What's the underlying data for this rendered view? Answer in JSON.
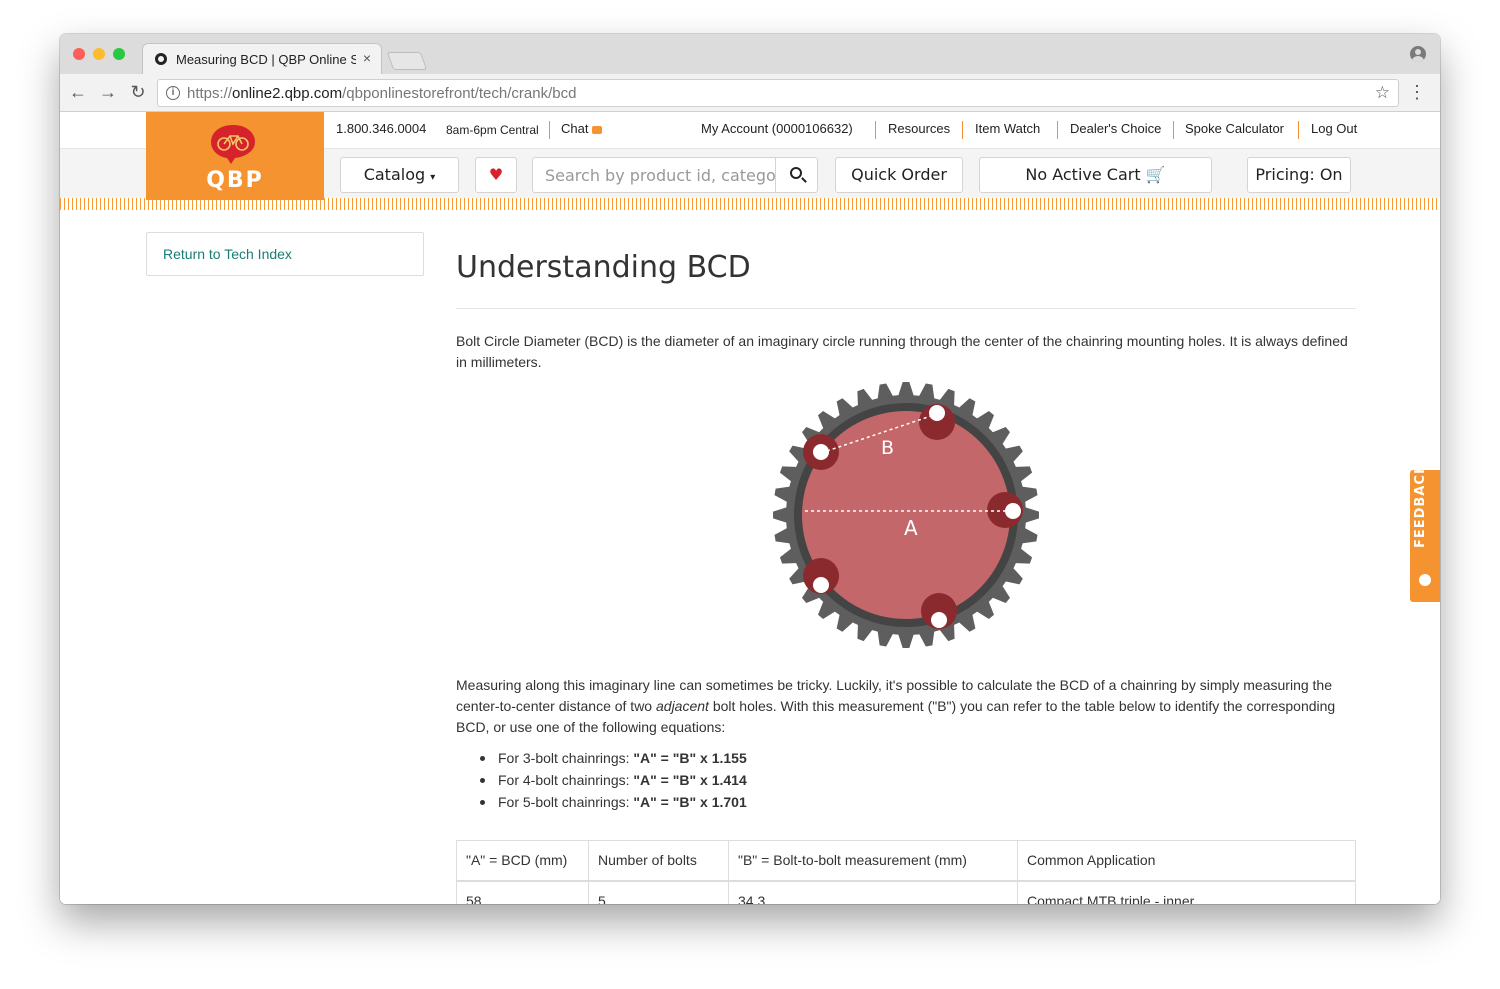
{
  "browser": {
    "tab_title": "Measuring BCD | QBP Online S",
    "tab_close": "×",
    "url_scheme": "https://",
    "url_host": "online2.qbp.com",
    "url_path": "/qbponlinestorefront/tech/crank/bcd"
  },
  "header": {
    "logo_text": "QBP",
    "phone": "1.800.346.0004",
    "hours": "8am-6pm Central",
    "chat": "Chat",
    "links": [
      "My Account (0000106632)",
      "Resources",
      "Item Watch",
      "Dealer's Choice",
      "Spoke Calculator",
      "Log Out"
    ]
  },
  "nav": {
    "catalog": "Catalog",
    "search_placeholder": "Search by product id, category, brand",
    "quick_order": "Quick Order",
    "cart": "No Active Cart",
    "pricing": "Pricing: On"
  },
  "sidebar": {
    "return_link": "Return to Tech Index"
  },
  "content": {
    "title": "Understanding BCD",
    "intro": "Bolt Circle Diameter (BCD) is the diameter of an imaginary circle running through the center of the chainring mounting holes. It is always defined in millimeters.",
    "diagram_labels": {
      "a": "A",
      "b": "B"
    },
    "p2_before": "Measuring along this imaginary line can sometimes be tricky. Luckily, it's possible to calculate the BCD of a chainring by simply measuring the center-to-center distance of two ",
    "p2_em": "adjacent",
    "p2_after": " bolt holes. With this measurement (\"B\") you can refer to the table below to identify the corresponding BCD, or use one of the following equations:",
    "bullets": [
      {
        "text": "For 3-bolt chainrings: ",
        "formula": "\"A\" = \"B\" x 1.155"
      },
      {
        "text": "For 4-bolt chainrings: ",
        "formula": "\"A\" = \"B\" x 1.414"
      },
      {
        "text": "For 5-bolt chainrings: ",
        "formula": "\"A\" = \"B\" x 1.701"
      }
    ],
    "table": {
      "headers": [
        "\"A\" = BCD (mm)",
        "Number of bolts",
        "\"B\" = Bolt-to-bolt measurement (mm)",
        "Common Application"
      ],
      "rows": [
        [
          "58",
          "5",
          "34.3",
          "Compact MTB triple - inner"
        ]
      ]
    }
  },
  "feedback": {
    "label": "FEEDBACK"
  },
  "colors": {
    "brand_orange": "#f4932f",
    "link_teal": "#1a7d74"
  }
}
